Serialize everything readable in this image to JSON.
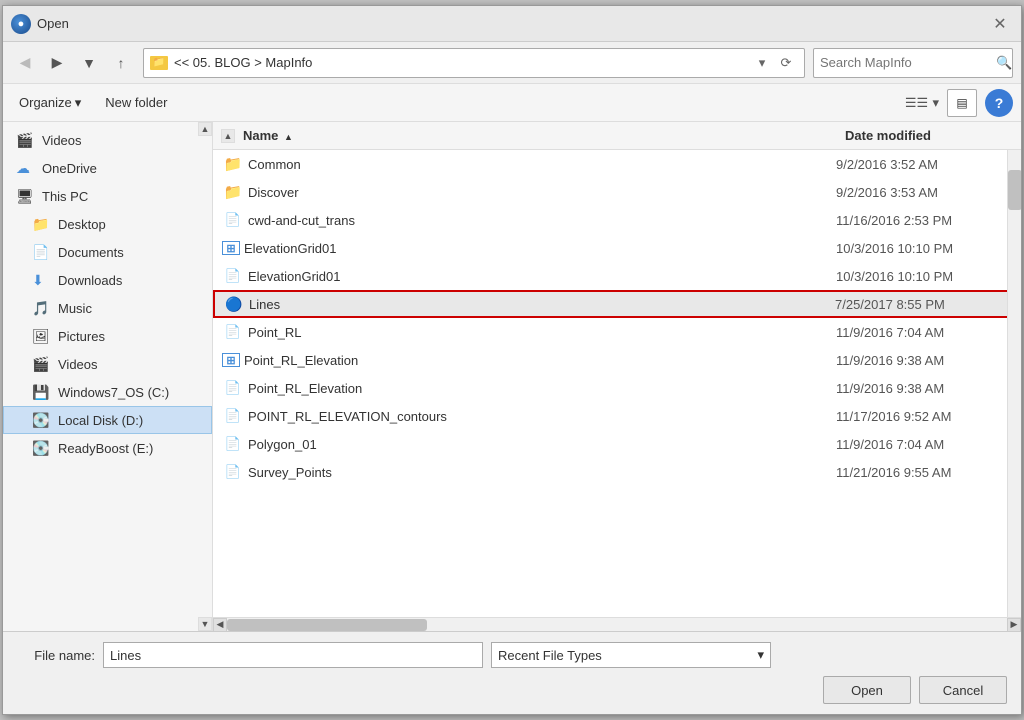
{
  "dialog": {
    "title": "Open",
    "close_label": "✕"
  },
  "toolbar": {
    "back_label": "◀",
    "forward_label": "▶",
    "dropdown_label": "▾",
    "up_label": "↑",
    "address_path": "<< 05. BLOG > MapInfo",
    "address_chevron": "▾",
    "address_refresh": "⟳",
    "search_placeholder": "Search MapInfo",
    "search_icon": "🔍"
  },
  "actionbar": {
    "organize_label": "Organize",
    "organize_chevron": "▾",
    "new_folder_label": "New folder",
    "view_icon": "☰",
    "view_chevron": "▾",
    "pane_icon": "▤",
    "help_label": "?"
  },
  "sidebar": {
    "items": [
      {
        "id": "videos",
        "label": "Videos",
        "icon": "🎬",
        "indent": 0
      },
      {
        "id": "onedrive",
        "label": "OneDrive",
        "icon": "☁",
        "indent": 0,
        "icon_color": "blue"
      },
      {
        "id": "thispc",
        "label": "This PC",
        "icon": "💻",
        "indent": 0
      },
      {
        "id": "desktop",
        "label": "Desktop",
        "icon": "📁",
        "indent": 1,
        "icon_color": "blue"
      },
      {
        "id": "documents",
        "label": "Documents",
        "icon": "📄",
        "indent": 1
      },
      {
        "id": "downloads",
        "label": "Downloads",
        "icon": "⬇",
        "indent": 1,
        "icon_color": "blue"
      },
      {
        "id": "music",
        "label": "Music",
        "icon": "🎵",
        "indent": 1
      },
      {
        "id": "pictures",
        "label": "Pictures",
        "icon": "🖼",
        "indent": 1
      },
      {
        "id": "videos2",
        "label": "Videos",
        "icon": "🎬",
        "indent": 1
      },
      {
        "id": "windows7",
        "label": "Windows7_OS (C:)",
        "icon": "💾",
        "indent": 1
      },
      {
        "id": "localdisk",
        "label": "Local Disk (D:)",
        "icon": "💽",
        "indent": 1,
        "selected": true
      },
      {
        "id": "readyboost",
        "label": "ReadyBoost (E:)",
        "icon": "💽",
        "indent": 1
      }
    ]
  },
  "filearea": {
    "col_name": "Name",
    "col_sort_arrow": "▲",
    "col_date": "Date modified",
    "files": [
      {
        "id": "common",
        "name": "Common",
        "icon": "📁",
        "icon_color": "folder",
        "date": "9/2/2016 3:52 AM"
      },
      {
        "id": "discover",
        "name": "Discover",
        "icon": "📁",
        "icon_color": "folder",
        "date": "9/2/2016 3:53 AM"
      },
      {
        "id": "cwd",
        "name": "cwd-and-cut_trans",
        "icon": "📄",
        "icon_color": "gray",
        "date": "11/16/2016 2:53 PM"
      },
      {
        "id": "elevgrid1",
        "name": "ElevationGrid01",
        "icon": "⊞",
        "icon_color": "blue",
        "date": "10/3/2016 10:10 PM"
      },
      {
        "id": "elevgrid2",
        "name": "ElevationGrid01",
        "icon": "📄",
        "icon_color": "gray",
        "date": "10/3/2016 10:10 PM"
      },
      {
        "id": "lines",
        "name": "Lines",
        "icon": "🔵",
        "icon_color": "blue",
        "date": "7/25/2017 8:55 PM",
        "highlighted": true
      },
      {
        "id": "pointrl",
        "name": "Point_RL",
        "icon": "📄",
        "icon_color": "gray",
        "date": "11/9/2016 7:04 AM"
      },
      {
        "id": "pointrl_elev1",
        "name": "Point_RL_Elevation",
        "icon": "⊞",
        "icon_color": "blue",
        "date": "11/9/2016 9:38 AM"
      },
      {
        "id": "pointrl_elev2",
        "name": "Point_RL_Elevation",
        "icon": "📄",
        "icon_color": "gray",
        "date": "11/9/2016 9:38 AM"
      },
      {
        "id": "point_contours",
        "name": "POINT_RL_ELEVATION_contours",
        "icon": "📄",
        "icon_color": "gray",
        "date": "11/17/2016 9:52 AM"
      },
      {
        "id": "polygon",
        "name": "Polygon_01",
        "icon": "📄",
        "icon_color": "gray",
        "date": "11/9/2016 7:04 AM"
      },
      {
        "id": "survey",
        "name": "Survey_Points",
        "icon": "📄",
        "icon_color": "gray",
        "date": "11/21/2016 9:55 AM"
      }
    ]
  },
  "bottombar": {
    "filename_label": "File name:",
    "filename_value": "Lines",
    "filetype_label": "Recent File Types",
    "filetype_chevron": "▾",
    "open_label": "Open",
    "cancel_label": "Cancel"
  }
}
